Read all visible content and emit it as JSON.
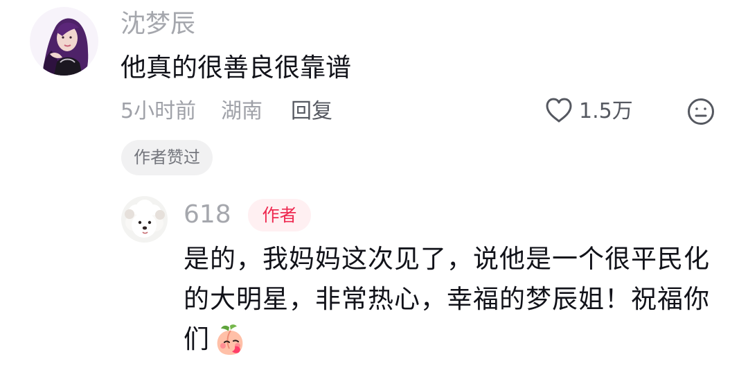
{
  "comment": {
    "username": "沈梦辰",
    "text": "他真的很善良很靠谱",
    "meta": {
      "time": "5小时前",
      "region": "湖南",
      "reply_label": "回复",
      "like_count": "1.5万"
    },
    "author_liked_badge": "作者赞过"
  },
  "reply": {
    "username": "618",
    "author_tag": "作者",
    "text": "是的，我妈妈这次见了，说他是一个很平民化的大明星，非常热心，幸福的梦辰姐！祝福你们"
  },
  "icons": {
    "like": "heart-icon",
    "emoji_reaction": "neutral-face-icon",
    "inline_emoji": "blushing-peach-emoji"
  },
  "colors": {
    "username": "#a5a7ad",
    "text": "#111219",
    "meta": "#9fa1a8",
    "action": "#555860",
    "author_tag_text": "#ee2950",
    "author_tag_background": "#fff0f2",
    "badge_background": "#f1f1f2"
  }
}
